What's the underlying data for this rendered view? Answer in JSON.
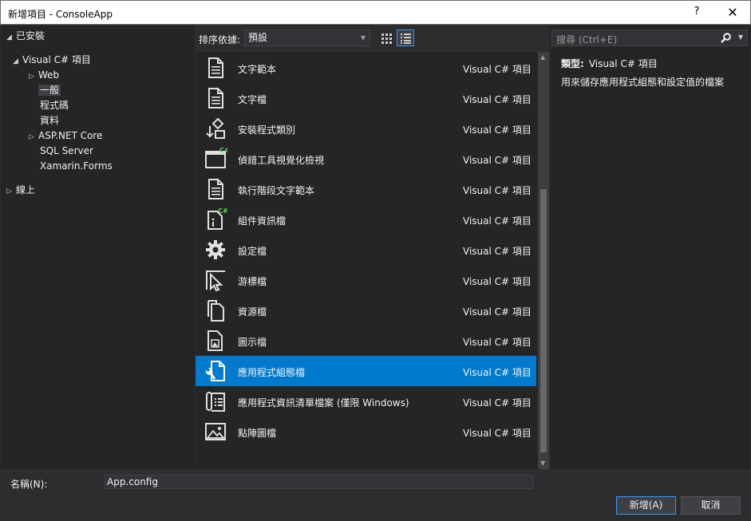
{
  "window": {
    "title": "新增項目 - ConsoleApp",
    "help": "?",
    "close": "✕"
  },
  "tree": {
    "installed": "已安裝",
    "visual_csharp": "Visual C# 項目",
    "web": "Web",
    "general": "一般",
    "code": "程式碼",
    "data": "資料",
    "aspnet_core": "ASP.NET Core",
    "sql_server": "SQL Server",
    "xamarin_forms": "Xamarin.Forms",
    "online": "線上"
  },
  "toolbar": {
    "sort_label": "排序依據:",
    "sort_value": "預設"
  },
  "items": [
    {
      "name": "文字範本",
      "type": "Visual C# 項目",
      "icon": "text-template-icon"
    },
    {
      "name": "文字檔",
      "type": "Visual C# 項目",
      "icon": "text-file-icon"
    },
    {
      "name": "安裝程式類別",
      "type": "Visual C# 項目",
      "icon": "installer-class-icon"
    },
    {
      "name": "偵錯工具視覺化檢視",
      "type": "Visual C# 項目",
      "icon": "debugger-visualizer-icon"
    },
    {
      "name": "執行階段文字範本",
      "type": "Visual C# 項目",
      "icon": "runtime-text-template-icon"
    },
    {
      "name": "組件資訊檔",
      "type": "Visual C# 項目",
      "icon": "assembly-info-icon"
    },
    {
      "name": "設定檔",
      "type": "Visual C# 項目",
      "icon": "settings-gear-icon"
    },
    {
      "name": "游標檔",
      "type": "Visual C# 項目",
      "icon": "cursor-icon"
    },
    {
      "name": "資源檔",
      "type": "Visual C# 項目",
      "icon": "resource-file-icon"
    },
    {
      "name": "圖示檔",
      "type": "Visual C# 項目",
      "icon": "icon-file-icon"
    },
    {
      "name": "應用程式組態檔",
      "type": "Visual C# 項目",
      "icon": "app-config-icon"
    },
    {
      "name": "應用程式資訊清單檔案 (僅限 Windows)",
      "type": "Visual C# 項目",
      "icon": "app-manifest-icon"
    },
    {
      "name": "點陣圖檔",
      "type": "Visual C# 項目",
      "icon": "bitmap-icon"
    }
  ],
  "search": {
    "placeholder": "搜尋 (Ctrl+E)"
  },
  "detail": {
    "type_label": "類型:",
    "type_value": "Visual C# 項目",
    "description": "用來儲存應用程式組態和設定值的檔案"
  },
  "bottom": {
    "name_label": "名稱(N):",
    "name_value": "App.config",
    "add_button": "新增(A)",
    "cancel_button": "取消"
  }
}
